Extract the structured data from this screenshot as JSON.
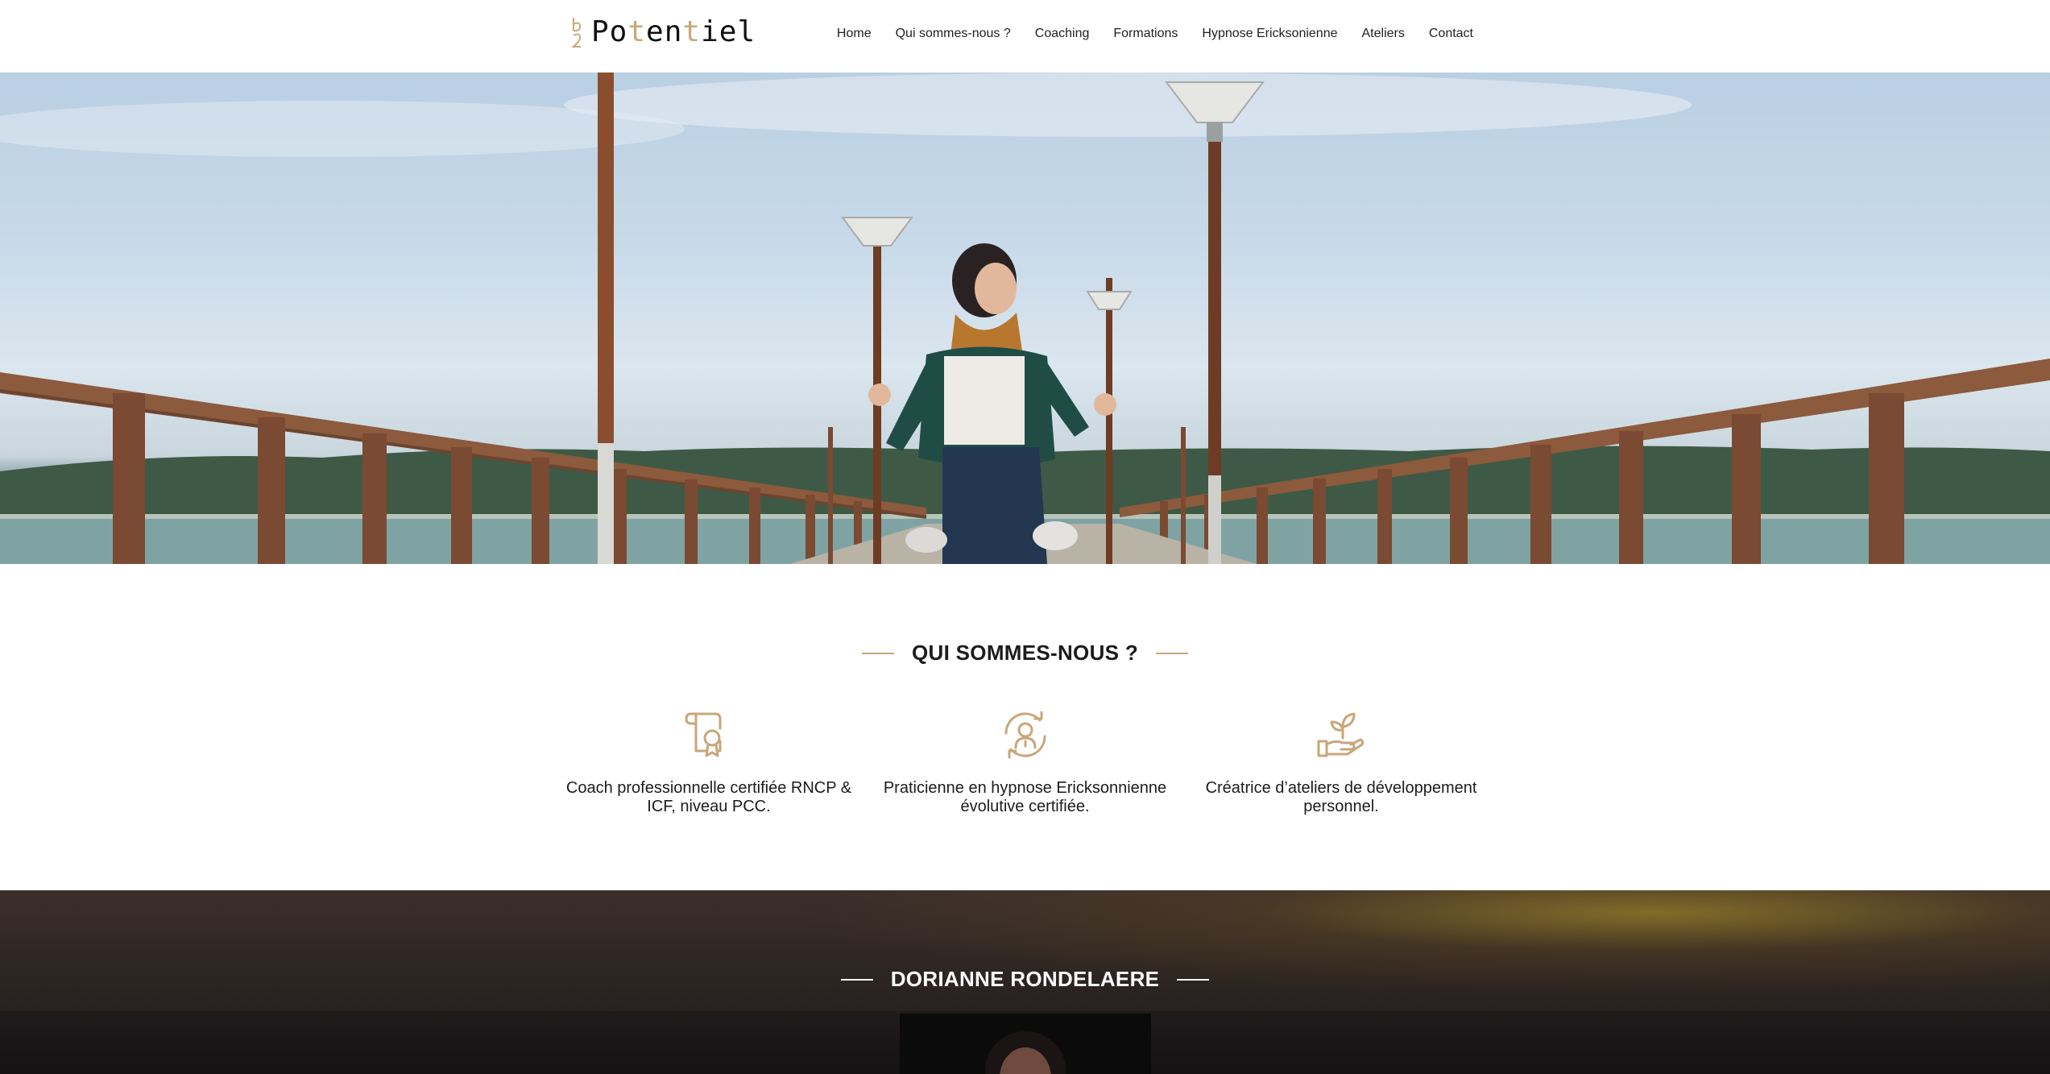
{
  "logo": {
    "mark_text": "b2",
    "text_part1": "Po",
    "text_t1": "t",
    "text_part2": "en",
    "text_t2": "t",
    "text_part3": "iel",
    "brand_color": "#c8a77a"
  },
  "nav": {
    "items": [
      "Home",
      "Qui sommes-nous ?",
      "Coaching",
      "Formations",
      "Hypnose Ericksonienne",
      "Ateliers",
      "Contact"
    ]
  },
  "about": {
    "title": "QUI SOMMES-NOUS ?",
    "features": [
      {
        "icon": "certificate-icon",
        "text": "Coach professionnelle certifiée RNCP & ICF, niveau PCC."
      },
      {
        "icon": "hypnosis-head-icon",
        "text": "Praticienne en hypnose Ericksonnienne évolutive certifiée."
      },
      {
        "icon": "hand-plant-icon",
        "text": "Créatrice d’ateliers de développement personnel."
      }
    ]
  },
  "person": {
    "title": "DORIANNE RONDELAERE"
  },
  "colors": {
    "accent": "#c8a77a",
    "text": "#1c1c1c",
    "dark_section": "#2f2623"
  }
}
